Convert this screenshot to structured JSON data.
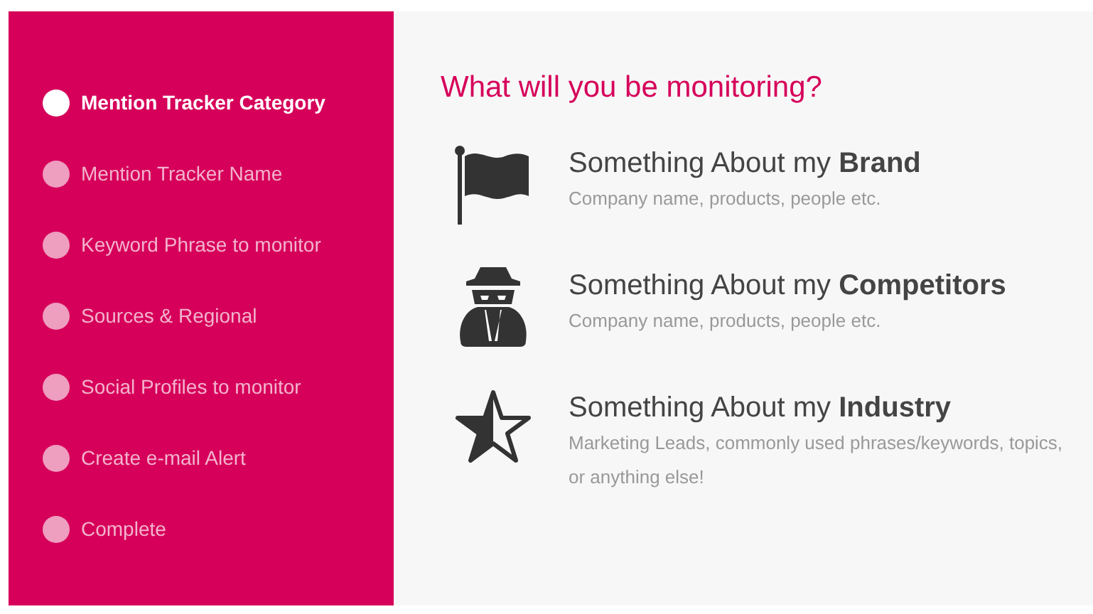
{
  "steps": [
    {
      "label": "Mention Tracker Category",
      "selected": true
    },
    {
      "label": "Mention Tracker Name",
      "selected": false
    },
    {
      "label": "Keyword Phrase to monitor",
      "selected": false
    },
    {
      "label": "Sources & Regional",
      "selected": false
    },
    {
      "label": "Social Profiles to monitor",
      "selected": false
    },
    {
      "label": "Create e-mail Alert",
      "selected": false
    },
    {
      "label": "Complete",
      "selected": false
    }
  ],
  "heading": "What will you be monitoring?",
  "options": [
    {
      "kind": "flag",
      "title": "Something About my **Brand**",
      "description": "Company name, products, people etc."
    },
    {
      "kind": "spy",
      "title": "Something About my **Competitors**",
      "description": "Company name, products, people etc."
    },
    {
      "kind": "star",
      "title": "Something About my **Industry**",
      "description": "Marketing Leads, commonly used phrases/keywords, topics, or anything else!"
    }
  ]
}
